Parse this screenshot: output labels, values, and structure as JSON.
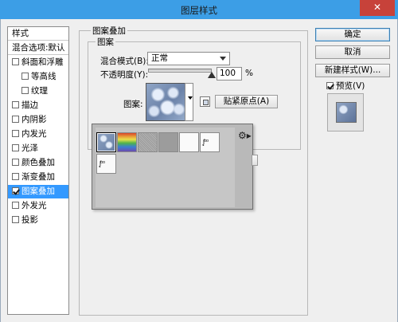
{
  "window": {
    "title": "图层样式",
    "close_glyph": "✕"
  },
  "sidebar": {
    "header": "样式",
    "items": [
      {
        "label": "混合选项:默认",
        "checkbox": false,
        "checked": false,
        "indent": false,
        "selected": false
      },
      {
        "label": "斜面和浮雕",
        "checkbox": true,
        "checked": false,
        "indent": false,
        "selected": false
      },
      {
        "label": "等高线",
        "checkbox": true,
        "checked": false,
        "indent": true,
        "selected": false
      },
      {
        "label": "纹理",
        "checkbox": true,
        "checked": false,
        "indent": true,
        "selected": false
      },
      {
        "label": "描边",
        "checkbox": true,
        "checked": false,
        "indent": false,
        "selected": false
      },
      {
        "label": "内阴影",
        "checkbox": true,
        "checked": false,
        "indent": false,
        "selected": false
      },
      {
        "label": "内发光",
        "checkbox": true,
        "checked": false,
        "indent": false,
        "selected": false
      },
      {
        "label": "光泽",
        "checkbox": true,
        "checked": false,
        "indent": false,
        "selected": false
      },
      {
        "label": "颜色叠加",
        "checkbox": true,
        "checked": false,
        "indent": false,
        "selected": false
      },
      {
        "label": "渐变叠加",
        "checkbox": true,
        "checked": false,
        "indent": false,
        "selected": false
      },
      {
        "label": "图案叠加",
        "checkbox": true,
        "checked": true,
        "indent": false,
        "selected": true
      },
      {
        "label": "外发光",
        "checkbox": true,
        "checked": false,
        "indent": false,
        "selected": false
      },
      {
        "label": "投影",
        "checkbox": true,
        "checked": false,
        "indent": false,
        "selected": false
      }
    ]
  },
  "panel": {
    "group_title": "图案叠加",
    "subgroup_title": "图案",
    "blend_mode_label": "混合模式(B):",
    "blend_mode_value": "正常",
    "opacity_label": "不透明度(Y):",
    "opacity_value": "100",
    "opacity_unit": "%",
    "opacity_level": 1.0,
    "pattern_label": "图案:",
    "snap_origin_button": "贴紧原点(A)"
  },
  "pattern_picker": {
    "gear_glyph": "⚙▸",
    "tiles": [
      {
        "name": "bubbles",
        "selected": true
      },
      {
        "name": "rainbow",
        "selected": false
      },
      {
        "name": "noise",
        "selected": false
      },
      {
        "name": "gray",
        "selected": false
      },
      {
        "name": "blank",
        "selected": false
      },
      {
        "name": "stamp-1",
        "glyph": "ᶘᵒᵒ",
        "selected": false
      },
      {
        "name": "stamp-2",
        "glyph": "ᶘᵒᵒ",
        "selected": false
      }
    ]
  },
  "actions": {
    "ok": "确定",
    "cancel": "取消",
    "new_style": "新建样式(W)...",
    "preview_label": "预览(V)",
    "preview_checked": true
  },
  "colors": {
    "titlebar": "#3c9ee6",
    "close_button": "#c7423a",
    "selection": "#3399ff"
  }
}
